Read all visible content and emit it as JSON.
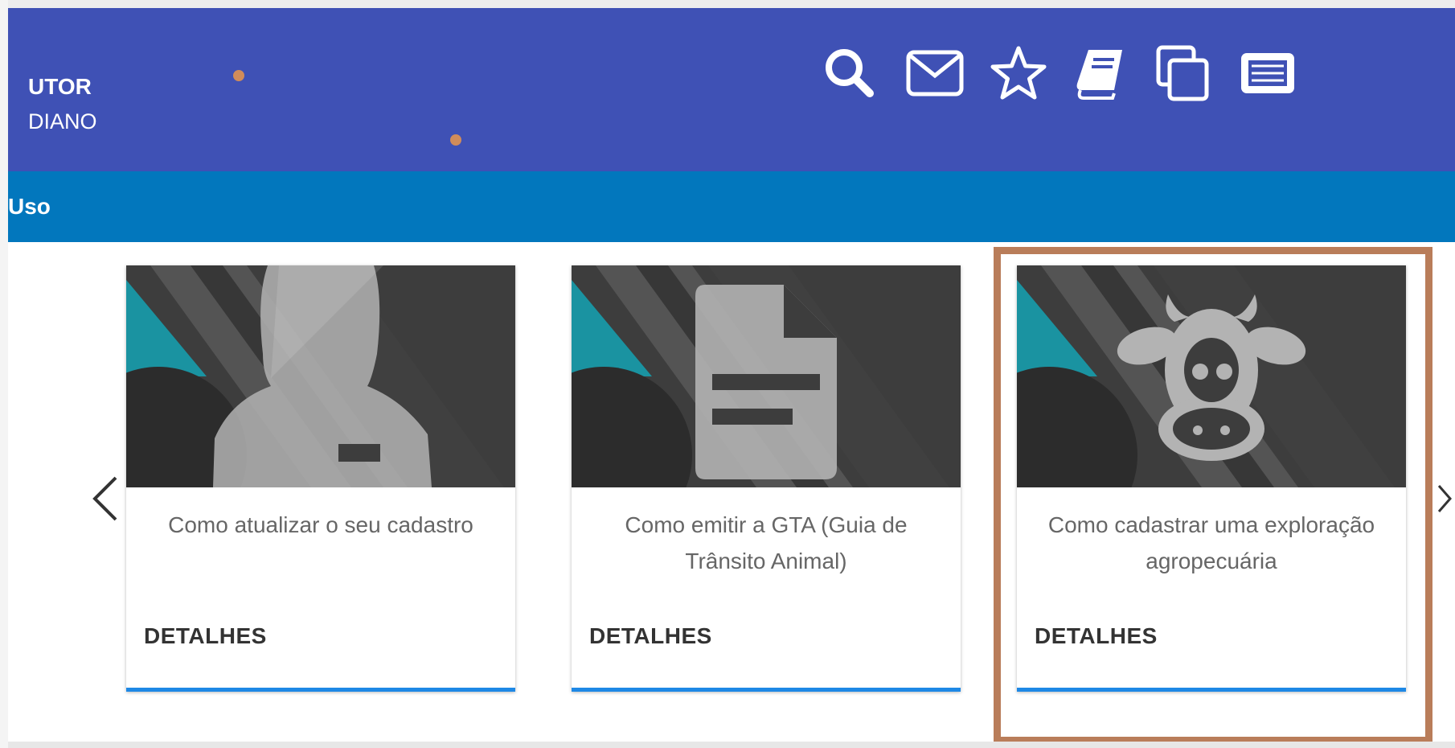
{
  "header": {
    "user_name": "UTOR",
    "user_role": "DIANO",
    "icons": [
      "search-icon",
      "mail-icon",
      "star-icon",
      "book-icon",
      "copy-icon",
      "list-icon"
    ]
  },
  "subnav": {
    "label": "Uso"
  },
  "carousel": {
    "prev_icon": "chevron-left-icon",
    "next_icon": "chevron-right-icon",
    "cards": [
      {
        "icon": "person-badge-icon",
        "title": "Como atualizar o seu cadastro",
        "link": "DETALHES"
      },
      {
        "icon": "document-icon",
        "title": "Como emitir a GTA (Guia de Trânsito Animal)",
        "link": "DETALHES"
      },
      {
        "icon": "cow-icon",
        "title": "Como cadastrar uma exploração agropecuária",
        "link": "DETALHES"
      }
    ]
  },
  "colors": {
    "header": "#3f51b5",
    "subnav": "#0277bd",
    "card_accent": "#1e88e5",
    "highlight": "#b97d5a",
    "media_bg": "#3d3d3d",
    "media_teal": "#1a93a1"
  }
}
